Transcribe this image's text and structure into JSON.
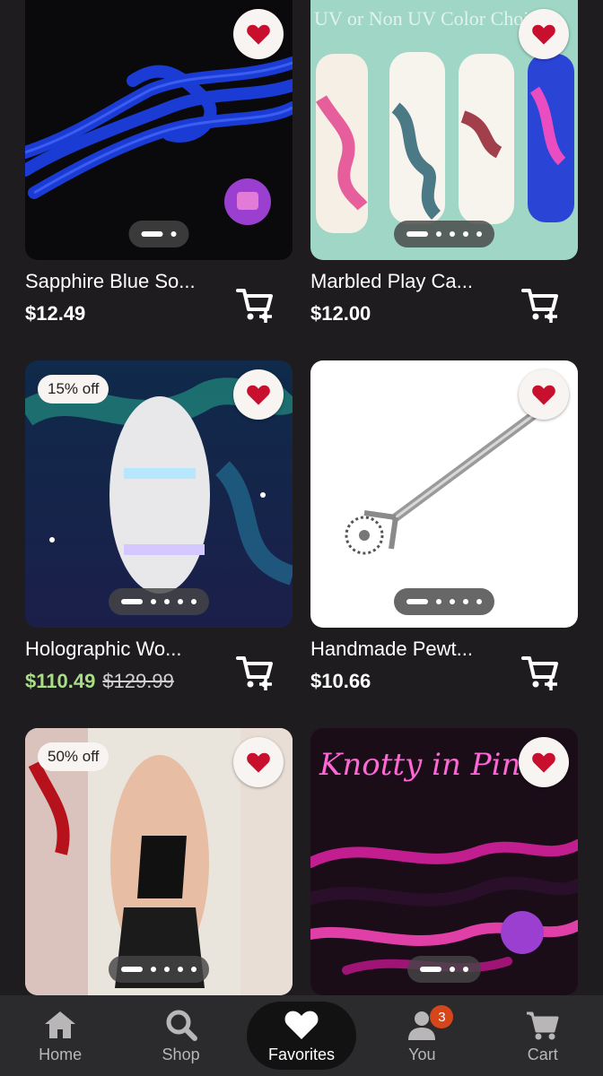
{
  "products": [
    {
      "title": "Sapphire Blue So...",
      "price": "$12.49",
      "original_price": "",
      "discount": "",
      "image_text": "",
      "images_count": 2
    },
    {
      "title": "Marbled Play Ca...",
      "price": "$12.00",
      "original_price": "",
      "discount": "",
      "image_text": "UV or Non UV Color Choice",
      "images_count": 5
    },
    {
      "title": "Holographic Wo...",
      "price": "$110.49",
      "original_price": "$129.99",
      "discount": "15% off",
      "image_text": "",
      "images_count": 5
    },
    {
      "title": "Handmade Pewt...",
      "price": "$10.66",
      "original_price": "",
      "discount": "",
      "image_text": "",
      "images_count": 5
    },
    {
      "title": "",
      "price": "",
      "original_price": "",
      "discount": "50% off",
      "image_text": "",
      "images_count": 5
    },
    {
      "title": "",
      "price": "",
      "original_price": "",
      "discount": "",
      "image_text": "Knotty in Pink",
      "images_count": 3
    }
  ],
  "colors": {
    "background": "#1e1c1f",
    "heart": "#c8102e",
    "sale_price": "#a9dd86",
    "badge_count": "#d5461b"
  },
  "nav": {
    "items": [
      {
        "label": "Home",
        "icon": "home-icon"
      },
      {
        "label": "Shop",
        "icon": "search-icon"
      },
      {
        "label": "Favorites",
        "icon": "heart-icon",
        "active": true
      },
      {
        "label": "You",
        "icon": "person-icon",
        "badge": "3"
      },
      {
        "label": "Cart",
        "icon": "cart-icon"
      }
    ]
  }
}
